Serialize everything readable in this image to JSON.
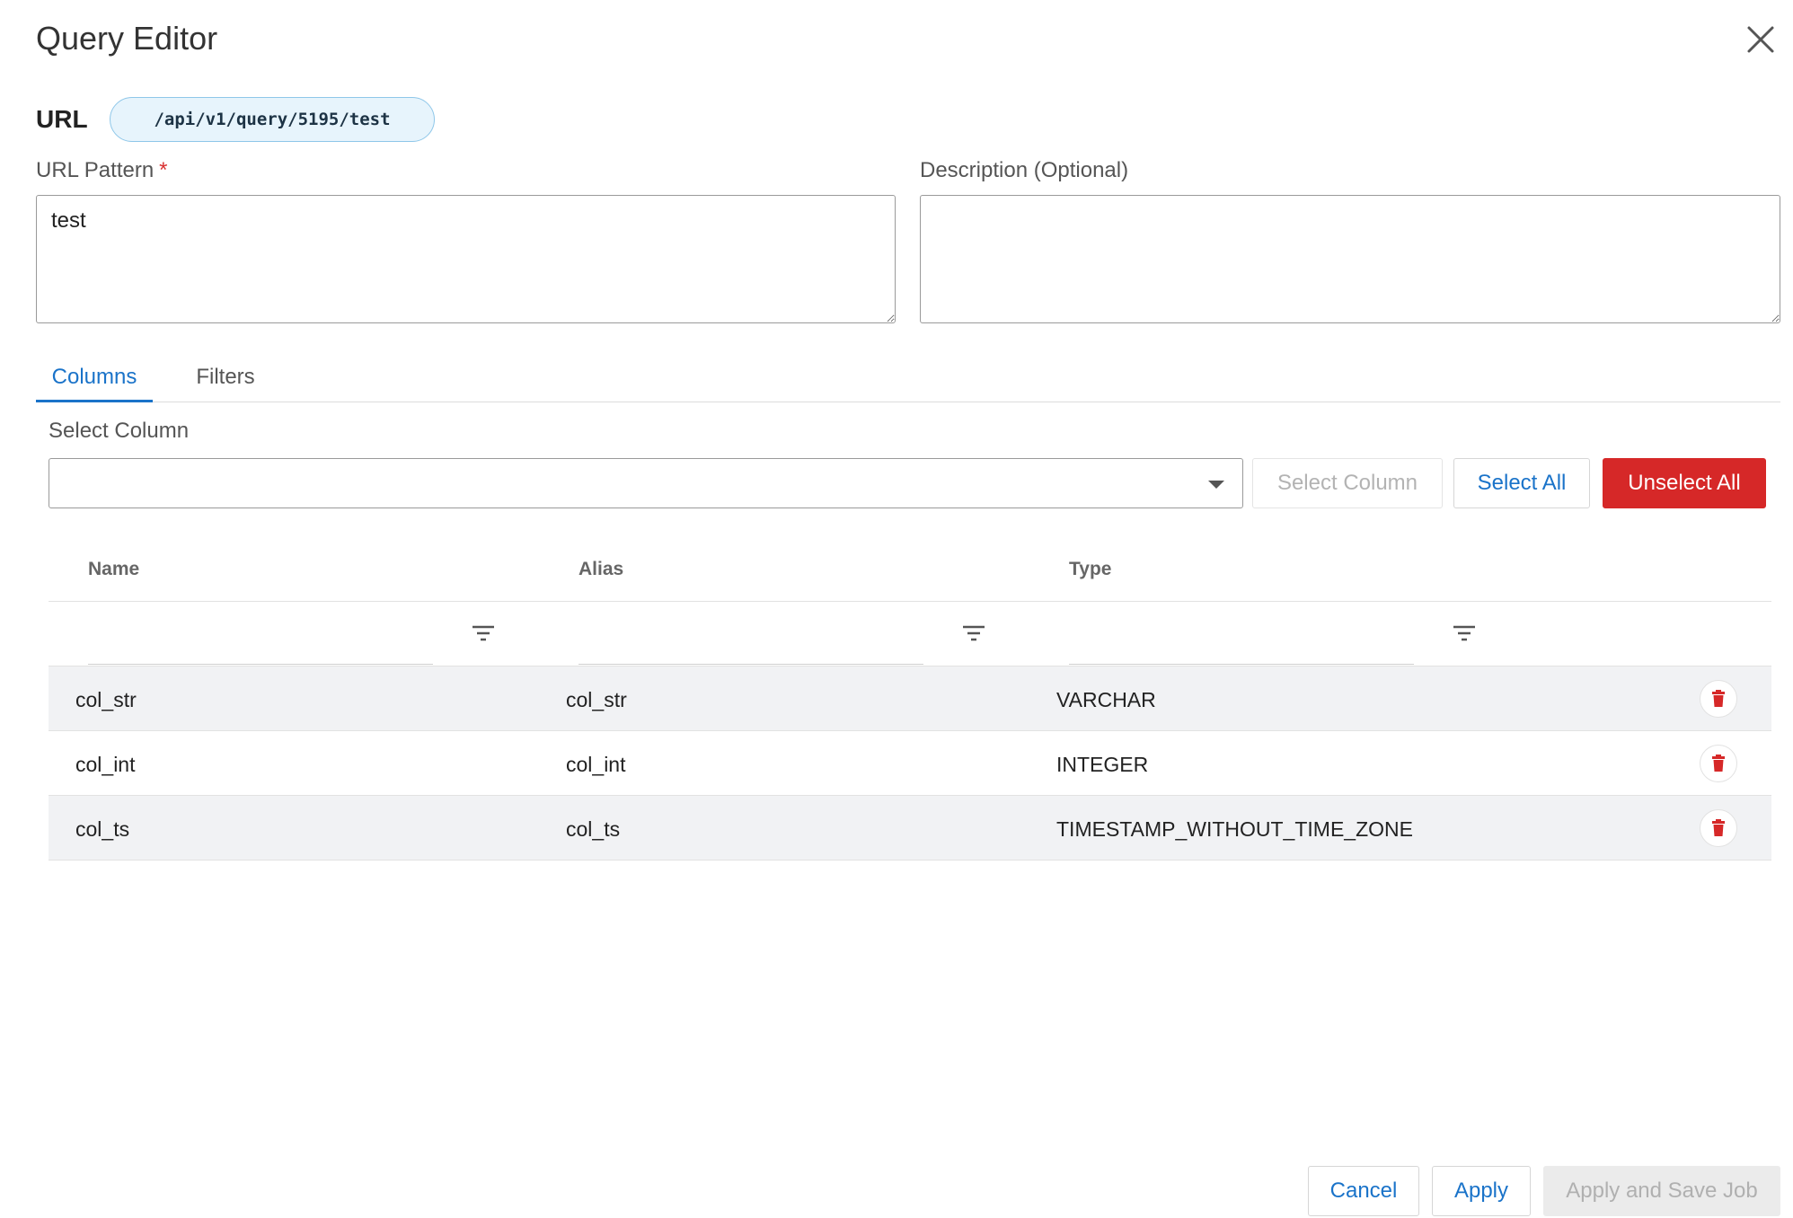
{
  "dialog": {
    "title": "Query Editor"
  },
  "url": {
    "label": "URL",
    "value": "/api/v1/query/5195/test"
  },
  "url_pattern": {
    "label": "URL Pattern",
    "required_mark": "*",
    "value": "test"
  },
  "description": {
    "label": "Description (Optional)",
    "value": ""
  },
  "tabs": [
    {
      "label": "Columns",
      "active": true
    },
    {
      "label": "Filters",
      "active": false
    }
  ],
  "column_select": {
    "label": "Select Column",
    "value": "",
    "select_button": "Select Column",
    "select_all_button": "Select All",
    "unselect_all_button": "Unselect All"
  },
  "table": {
    "headers": [
      "Name",
      "Alias",
      "Type"
    ],
    "rows": [
      {
        "name": "col_str",
        "alias": "col_str",
        "type": "VARCHAR"
      },
      {
        "name": "col_int",
        "alias": "col_int",
        "type": "INTEGER"
      },
      {
        "name": "col_ts",
        "alias": "col_ts",
        "type": "TIMESTAMP_WITHOUT_TIME_ZONE"
      }
    ]
  },
  "footer": {
    "cancel": "Cancel",
    "apply": "Apply",
    "apply_save": "Apply and Save Job"
  },
  "colors": {
    "accent": "#1a73c9",
    "danger": "#d62828",
    "url_badge_bg": "#e7f4fc"
  },
  "icons": {
    "close": "close-icon",
    "dropdown": "chevron-down-icon",
    "filter": "filter-icon",
    "delete": "trash-icon"
  }
}
